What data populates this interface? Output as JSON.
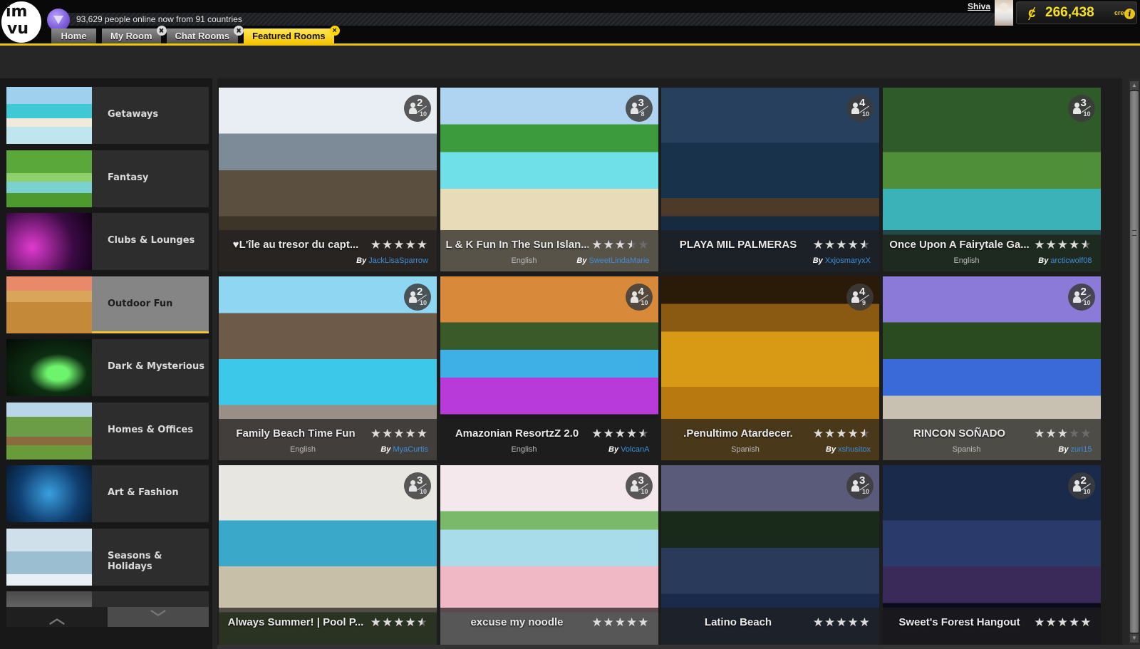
{
  "header": {
    "online_text": "93,629 people online now from 91 countries",
    "tabs": [
      {
        "label": "Home",
        "closable": false,
        "active": false
      },
      {
        "label": "My Room",
        "closable": true,
        "active": false
      },
      {
        "label": "Chat Rooms",
        "closable": true,
        "active": false
      },
      {
        "label": "Featured Rooms",
        "closable": true,
        "active": true
      }
    ],
    "close_glyph": "×",
    "username": "Shiva",
    "credits_amount": "266,438",
    "credits_label": "credits",
    "credits_icon": "ȼ",
    "info_glyph": "i"
  },
  "sidebar": {
    "categories": [
      {
        "label": "Getaways",
        "active": false
      },
      {
        "label": "Fantasy",
        "active": false
      },
      {
        "label": "Clubs & Lounges",
        "active": false
      },
      {
        "label": "Outdoor Fun",
        "active": true
      },
      {
        "label": "Dark & Mysterious",
        "active": false
      },
      {
        "label": "Homes & Offices",
        "active": false
      },
      {
        "label": "Art & Fashion",
        "active": false
      },
      {
        "label": "Seasons & Holidays",
        "active": false
      },
      {
        "label": "",
        "active": false
      }
    ],
    "scroll_up_glyph": "︿",
    "scroll_down_glyph": "﹀"
  },
  "rooms": [
    {
      "title": "♥L'île au tresor du capt...",
      "rating": 5,
      "language": "",
      "by": "By",
      "author": "JackLisaSparrow",
      "occupants": 2,
      "capacity": 10
    },
    {
      "title": "L & K Fun In The Sun Islan...",
      "rating": 3.5,
      "language": "English",
      "by": "By",
      "author": "SweetLindaMarie",
      "occupants": 3,
      "capacity": 8
    },
    {
      "title": "PLAYA MIL PALMERAS",
      "rating": 4.5,
      "language": "",
      "by": "By",
      "author": "XxjosmaryxX",
      "occupants": 4,
      "capacity": 10
    },
    {
      "title": "Once Upon A Fairytale Ga...",
      "rating": 4.5,
      "language": "English",
      "by": "By",
      "author": "arcticwolf08",
      "occupants": 3,
      "capacity": 10
    },
    {
      "title": "Family Beach Time Fun",
      "rating": 5,
      "language": "English",
      "by": "By",
      "author": "MyaCurtis",
      "occupants": 2,
      "capacity": 10
    },
    {
      "title": "Amazonian ResortzZ 2.0",
      "rating": 4.5,
      "language": "English",
      "by": "By",
      "author": "VolcanA",
      "occupants": 4,
      "capacity": 10
    },
    {
      "title": ".Penultimo Atardecer.",
      "rating": 4.5,
      "language": "Spanish",
      "by": "By",
      "author": "xshusitox",
      "occupants": 4,
      "capacity": 9
    },
    {
      "title": "RINCON SOÑADO",
      "rating": 3,
      "language": "Spanish",
      "by": "By",
      "author": "zuri15",
      "occupants": 2,
      "capacity": 10
    },
    {
      "title": "Always Summer! | Pool P...",
      "rating": 4.5,
      "language": "",
      "by": "",
      "author": "",
      "occupants": 3,
      "capacity": 10
    },
    {
      "title": "excuse my noodle",
      "rating": 5,
      "language": "",
      "by": "",
      "author": "",
      "occupants": 3,
      "capacity": 10
    },
    {
      "title": "Latino Beach",
      "rating": 5,
      "language": "",
      "by": "",
      "author": "",
      "occupants": 3,
      "capacity": 10
    },
    {
      "title": "Sweet's Forest Hangout",
      "rating": 5,
      "language": "",
      "by": "",
      "author": "",
      "occupants": 2,
      "capacity": 10
    }
  ],
  "scrollbar": {
    "up_glyph": "▲",
    "down_glyph": "▼"
  }
}
